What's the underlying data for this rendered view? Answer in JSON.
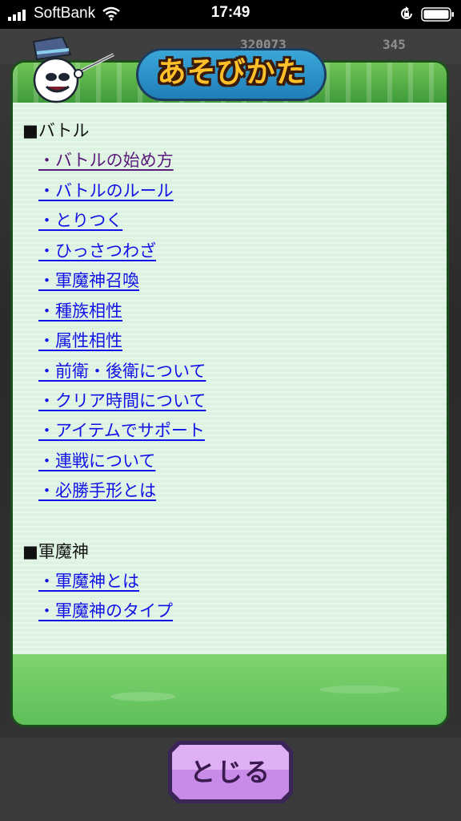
{
  "status_bar": {
    "carrier": "SoftBank",
    "time": "17:49"
  },
  "game_bg": {
    "stat1": "320073",
    "stat2": "345"
  },
  "dialog": {
    "title": "あそびかた",
    "sections": [
      {
        "heading": "■バトル",
        "links": [
          "・バトルの始め方",
          "・バトルのルール",
          "・とりつく",
          "・ひっさつわざ",
          "・軍魔神召喚",
          "・種族相性",
          "・属性相性",
          "・前衛・後衛について",
          "・クリア時間について",
          "・アイテムでサポート",
          "・連戦について",
          "・必勝手形とは"
        ]
      },
      {
        "heading": "■軍魔神",
        "links": [
          "・軍魔神とは",
          "・軍魔神のタイプ"
        ]
      }
    ],
    "close_label": "とじる"
  },
  "icons": {
    "signal": "signal-bars-icon",
    "wifi": "wifi-icon",
    "rotation_lock": "rotation-lock-icon",
    "battery": "battery-icon"
  },
  "colors": {
    "link": "#1212e8",
    "link_visited": "#5a1a7a",
    "dialog_frame": "#4da84a",
    "content_bg": "#ddf3e2",
    "title_plate": "#1f7fb8",
    "title_text": "#ffc02a",
    "close_button": "#c98be8"
  }
}
